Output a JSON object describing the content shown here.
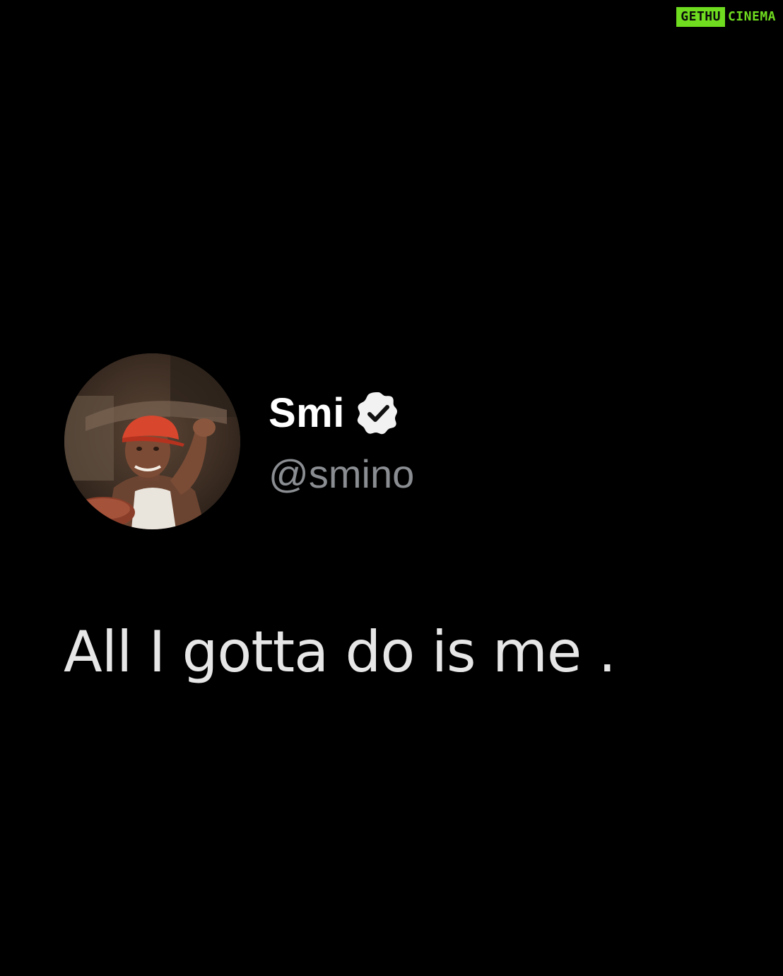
{
  "watermark": {
    "left": "GETHU",
    "right": "CINEMA",
    "color": "#6fdc1f"
  },
  "tweet": {
    "display_name": "Smi",
    "handle": "@smino",
    "verified": true,
    "text": "All I gotta do is me .",
    "icons": {
      "verified": "verified-badge-icon"
    }
  },
  "colors": {
    "background": "#000000",
    "name": "#ffffff",
    "handle": "#8a8d91",
    "text": "#e6e6e6"
  }
}
